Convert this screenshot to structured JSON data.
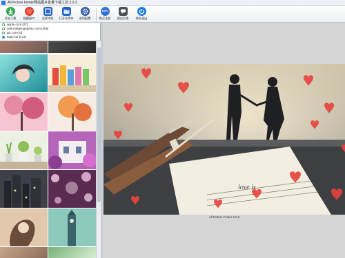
{
  "window": {
    "title": "All Picture Finder网站图片批量下载工具 3.0.3"
  },
  "toolbar": {
    "buttons": [
      {
        "label": "开始下载",
        "icon": "download-icon",
        "color": "#2fa84f"
      },
      {
        "label": "隐藏窗口",
        "icon": "hide-window-icon",
        "color": "#d93a2b"
      },
      {
        "label": "全屏浏览",
        "icon": "fullscreen-icon",
        "color": "#2466c8"
      },
      {
        "label": "打开文件夹",
        "icon": "folder-icon",
        "color": "#2466c8"
      },
      {
        "label": "选项配置",
        "icon": "gear-icon",
        "color": "#2d5aa8"
      },
      {
        "label": "购买注册",
        "icon": "100-badge-icon",
        "color": "#2f6fd1",
        "text": "100%"
      },
      {
        "label": "建议反馈",
        "icon": "feedback-icon",
        "color": "#4b4f55"
      },
      {
        "label": "保存退出",
        "icon": "power-icon",
        "color": "#1e7be0"
      }
    ]
  },
  "tree": {
    "items": [
      {
        "label": "apple.com [27]"
      },
      {
        "label": "nationalgeographic.com [206]"
      },
      {
        "label": "pic.com [0]"
      },
      {
        "label": "topit.me [172]"
      }
    ]
  },
  "thumbnails": [
    {
      "name": "thumb-girl-cyan",
      "colors": [
        "#7fd2d4",
        "#2aa0a8"
      ]
    },
    {
      "name": "thumb-bottles",
      "colors": [
        "#f2c14a",
        "#c6503a"
      ]
    },
    {
      "name": "thumb-pink-blossom",
      "colors": [
        "#f6b9c8",
        "#d9607f"
      ]
    },
    {
      "name": "thumb-autumn-tree",
      "colors": [
        "#f3a35a",
        "#f2e7dc"
      ]
    },
    {
      "name": "thumb-potted-plants",
      "colors": [
        "#b8d47a",
        "#e8efe0"
      ]
    },
    {
      "name": "thumb-purple-cottage",
      "colors": [
        "#a45bb3",
        "#f2c4e0"
      ]
    },
    {
      "name": "thumb-city-night",
      "colors": [
        "#404248",
        "#c8b27a"
      ]
    },
    {
      "name": "thumb-bokeh-i-love-you",
      "colors": [
        "#5a2a4e",
        "#f0c6e2"
      ]
    },
    {
      "name": "thumb-girl-hair",
      "colors": [
        "#d8b89a",
        "#6b4b3a"
      ]
    },
    {
      "name": "thumb-clock-tower",
      "colors": [
        "#2d6f76",
        "#9ed0c2"
      ]
    },
    {
      "name": "thumb-partial-1",
      "colors": [
        "#c9a58b",
        "#8b6d5a"
      ]
    },
    {
      "name": "thumb-partial-2",
      "colors": [
        "#7ab27a",
        "#d6ecd0"
      ]
    }
  ],
  "preview": {
    "text_on_paper": "love is",
    "status_caption": "All Picture Finder 3.0.3"
  }
}
